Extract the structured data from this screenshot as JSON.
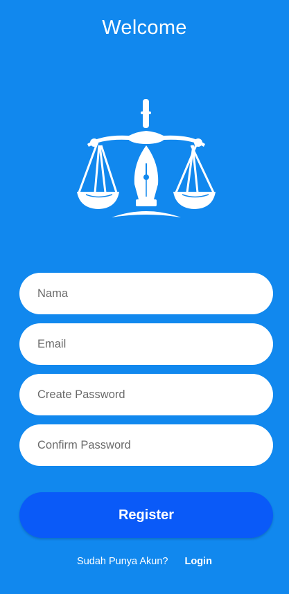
{
  "header": {
    "title": "Welcome"
  },
  "logo": {
    "icon": "scales-of-justice-pen-icon"
  },
  "form": {
    "name_placeholder": "Nama",
    "email_placeholder": "Email",
    "password_placeholder": "Create Password",
    "confirm_placeholder": "Confirm Password",
    "register_label": "Register"
  },
  "footer": {
    "question": "Sudah Punya Akun?",
    "login_label": "Login"
  },
  "colors": {
    "background": "#1188ee",
    "button": "#0a5af8",
    "field": "#ffffff"
  }
}
